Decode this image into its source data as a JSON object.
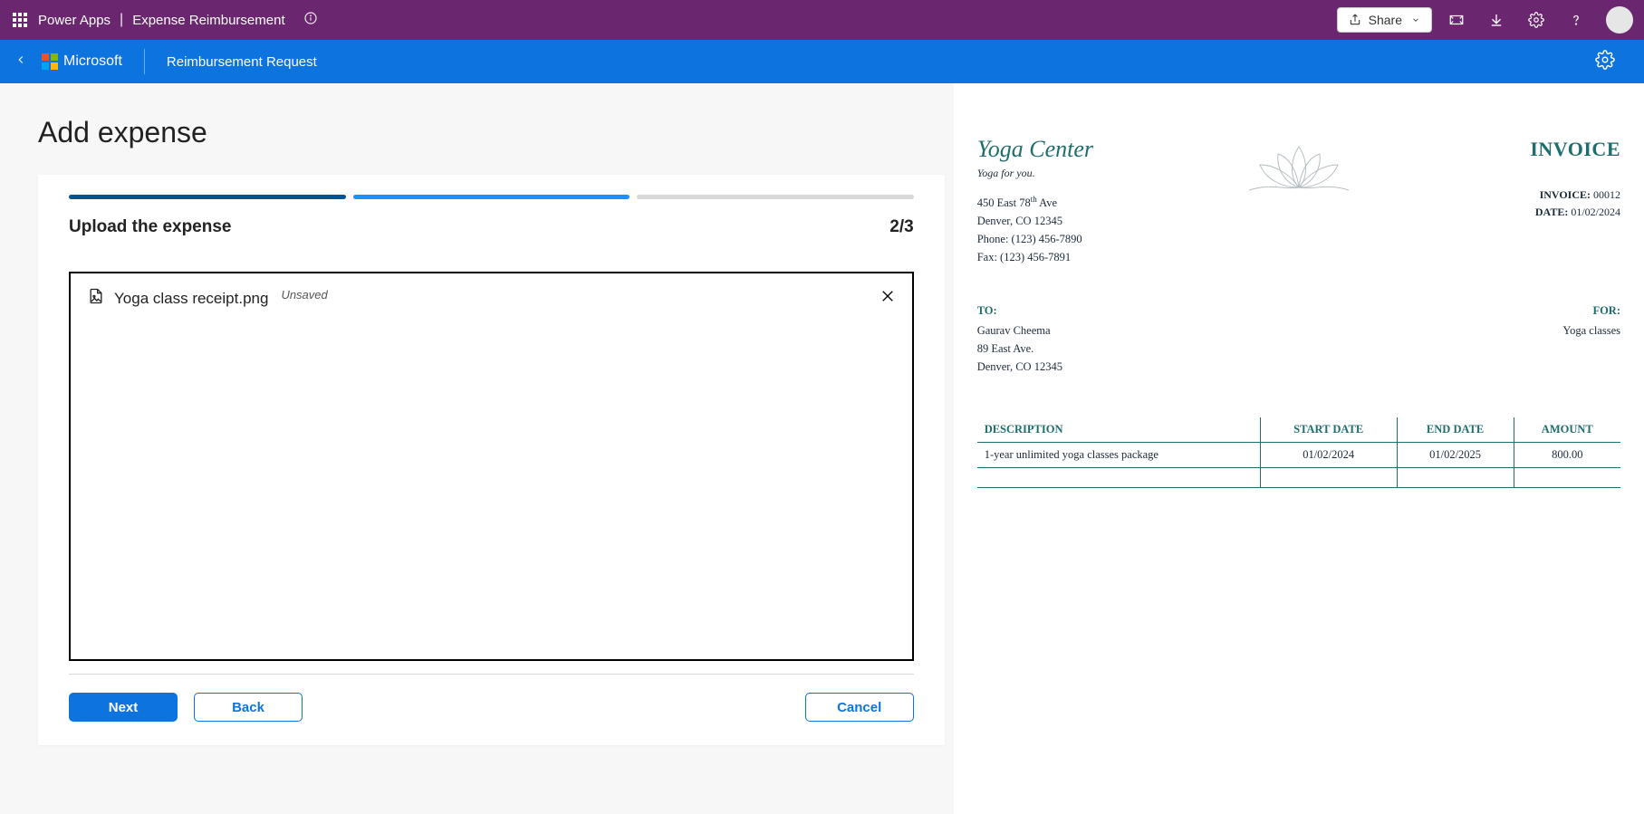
{
  "topbar": {
    "brand": "Power Apps",
    "app": "Expense Reimbursement",
    "share": "Share"
  },
  "appbar": {
    "ms": "Microsoft",
    "page": "Reimbursement Request"
  },
  "main": {
    "title": "Add expense",
    "step_label": "Upload the expense",
    "step_count": "2/3",
    "file_name": "Yoga class receipt.png",
    "file_status": "Unsaved",
    "next": "Next",
    "back": "Back",
    "cancel": "Cancel"
  },
  "invoice": {
    "brand": "Yoga Center",
    "tagline": "Yoga for you.",
    "addr1": "450 East 78",
    "addr1_suffix": "th",
    "addr1_tail": " Ave",
    "addr2": "Denver, CO 12345",
    "phone": "Phone: (123) 456-7890",
    "fax": "Fax: (123) 456-7891",
    "title": "INVOICE",
    "meta_invoice_label": "INVOICE:",
    "meta_invoice_no": "00012",
    "meta_date_label": "DATE:",
    "meta_date": "01/02/2024",
    "to_label": "TO:",
    "to_name": "Gaurav Cheema",
    "to_addr1": "89 East Ave.",
    "to_addr2": "Denver, CO 12345",
    "for_label": "FOR:",
    "for_value": "Yoga classes",
    "th_desc": "DESCRIPTION",
    "th_start": "START DATE",
    "th_end": "END DATE",
    "th_amount": "AMOUNT",
    "row_desc": "1-year unlimited yoga classes package",
    "row_start": "01/02/2024",
    "row_end": "01/02/2025",
    "row_amount": "800.00"
  }
}
